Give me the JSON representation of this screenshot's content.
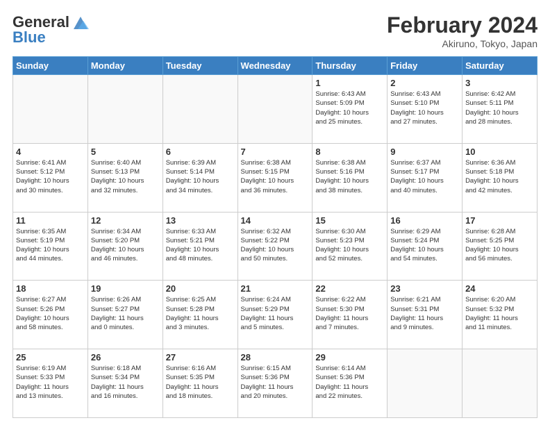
{
  "header": {
    "logo_line1": "General",
    "logo_line2": "Blue",
    "month_year": "February 2024",
    "location": "Akiruno, Tokyo, Japan"
  },
  "weekdays": [
    "Sunday",
    "Monday",
    "Tuesday",
    "Wednesday",
    "Thursday",
    "Friday",
    "Saturday"
  ],
  "weeks": [
    [
      {
        "day": "",
        "info": ""
      },
      {
        "day": "",
        "info": ""
      },
      {
        "day": "",
        "info": ""
      },
      {
        "day": "",
        "info": ""
      },
      {
        "day": "1",
        "info": "Sunrise: 6:43 AM\nSunset: 5:09 PM\nDaylight: 10 hours\nand 25 minutes."
      },
      {
        "day": "2",
        "info": "Sunrise: 6:43 AM\nSunset: 5:10 PM\nDaylight: 10 hours\nand 27 minutes."
      },
      {
        "day": "3",
        "info": "Sunrise: 6:42 AM\nSunset: 5:11 PM\nDaylight: 10 hours\nand 28 minutes."
      }
    ],
    [
      {
        "day": "4",
        "info": "Sunrise: 6:41 AM\nSunset: 5:12 PM\nDaylight: 10 hours\nand 30 minutes."
      },
      {
        "day": "5",
        "info": "Sunrise: 6:40 AM\nSunset: 5:13 PM\nDaylight: 10 hours\nand 32 minutes."
      },
      {
        "day": "6",
        "info": "Sunrise: 6:39 AM\nSunset: 5:14 PM\nDaylight: 10 hours\nand 34 minutes."
      },
      {
        "day": "7",
        "info": "Sunrise: 6:38 AM\nSunset: 5:15 PM\nDaylight: 10 hours\nand 36 minutes."
      },
      {
        "day": "8",
        "info": "Sunrise: 6:38 AM\nSunset: 5:16 PM\nDaylight: 10 hours\nand 38 minutes."
      },
      {
        "day": "9",
        "info": "Sunrise: 6:37 AM\nSunset: 5:17 PM\nDaylight: 10 hours\nand 40 minutes."
      },
      {
        "day": "10",
        "info": "Sunrise: 6:36 AM\nSunset: 5:18 PM\nDaylight: 10 hours\nand 42 minutes."
      }
    ],
    [
      {
        "day": "11",
        "info": "Sunrise: 6:35 AM\nSunset: 5:19 PM\nDaylight: 10 hours\nand 44 minutes."
      },
      {
        "day": "12",
        "info": "Sunrise: 6:34 AM\nSunset: 5:20 PM\nDaylight: 10 hours\nand 46 minutes."
      },
      {
        "day": "13",
        "info": "Sunrise: 6:33 AM\nSunset: 5:21 PM\nDaylight: 10 hours\nand 48 minutes."
      },
      {
        "day": "14",
        "info": "Sunrise: 6:32 AM\nSunset: 5:22 PM\nDaylight: 10 hours\nand 50 minutes."
      },
      {
        "day": "15",
        "info": "Sunrise: 6:30 AM\nSunset: 5:23 PM\nDaylight: 10 hours\nand 52 minutes."
      },
      {
        "day": "16",
        "info": "Sunrise: 6:29 AM\nSunset: 5:24 PM\nDaylight: 10 hours\nand 54 minutes."
      },
      {
        "day": "17",
        "info": "Sunrise: 6:28 AM\nSunset: 5:25 PM\nDaylight: 10 hours\nand 56 minutes."
      }
    ],
    [
      {
        "day": "18",
        "info": "Sunrise: 6:27 AM\nSunset: 5:26 PM\nDaylight: 10 hours\nand 58 minutes."
      },
      {
        "day": "19",
        "info": "Sunrise: 6:26 AM\nSunset: 5:27 PM\nDaylight: 11 hours\nand 0 minutes."
      },
      {
        "day": "20",
        "info": "Sunrise: 6:25 AM\nSunset: 5:28 PM\nDaylight: 11 hours\nand 3 minutes."
      },
      {
        "day": "21",
        "info": "Sunrise: 6:24 AM\nSunset: 5:29 PM\nDaylight: 11 hours\nand 5 minutes."
      },
      {
        "day": "22",
        "info": "Sunrise: 6:22 AM\nSunset: 5:30 PM\nDaylight: 11 hours\nand 7 minutes."
      },
      {
        "day": "23",
        "info": "Sunrise: 6:21 AM\nSunset: 5:31 PM\nDaylight: 11 hours\nand 9 minutes."
      },
      {
        "day": "24",
        "info": "Sunrise: 6:20 AM\nSunset: 5:32 PM\nDaylight: 11 hours\nand 11 minutes."
      }
    ],
    [
      {
        "day": "25",
        "info": "Sunrise: 6:19 AM\nSunset: 5:33 PM\nDaylight: 11 hours\nand 13 minutes."
      },
      {
        "day": "26",
        "info": "Sunrise: 6:18 AM\nSunset: 5:34 PM\nDaylight: 11 hours\nand 16 minutes."
      },
      {
        "day": "27",
        "info": "Sunrise: 6:16 AM\nSunset: 5:35 PM\nDaylight: 11 hours\nand 18 minutes."
      },
      {
        "day": "28",
        "info": "Sunrise: 6:15 AM\nSunset: 5:36 PM\nDaylight: 11 hours\nand 20 minutes."
      },
      {
        "day": "29",
        "info": "Sunrise: 6:14 AM\nSunset: 5:36 PM\nDaylight: 11 hours\nand 22 minutes."
      },
      {
        "day": "",
        "info": ""
      },
      {
        "day": "",
        "info": ""
      }
    ]
  ]
}
